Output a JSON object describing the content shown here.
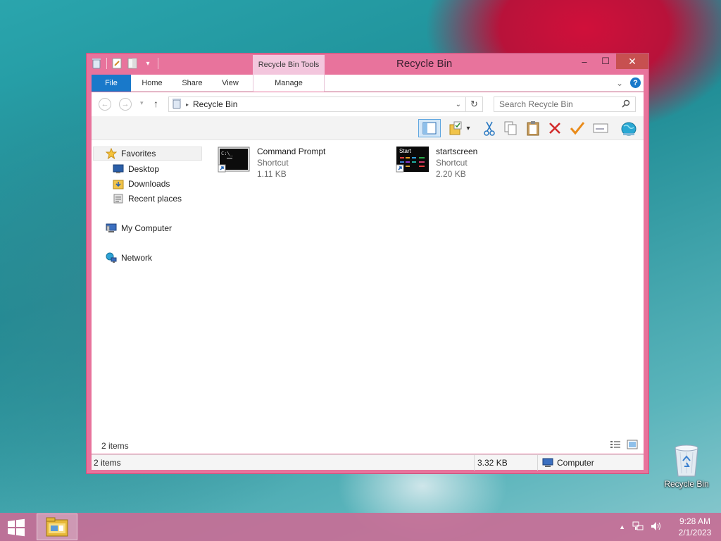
{
  "window": {
    "title": "Recycle Bin",
    "contextual_tab": "Recycle Bin Tools",
    "controls": {
      "minimize": "–",
      "maximize": "☐",
      "close": "✕"
    }
  },
  "ribbon": {
    "tabs": [
      "File",
      "Home",
      "Share",
      "View",
      "Manage"
    ]
  },
  "address": {
    "path": "Recycle Bin",
    "search_placeholder": "Search Recycle Bin"
  },
  "nav": {
    "favorites": "Favorites",
    "desktop": "Desktop",
    "downloads": "Downloads",
    "recent": "Recent places",
    "computer": "My Computer",
    "network": "Network"
  },
  "files": [
    {
      "name": "Command Prompt",
      "type": "Shortcut",
      "size": "1.11 KB",
      "icon": "command-prompt-icon"
    },
    {
      "name": "startscreen",
      "type": "Shortcut",
      "size": "2.20 KB",
      "icon": "start-screen-icon",
      "thumb_text": "Start"
    }
  ],
  "items_summary": "2 items",
  "status": {
    "items": "2 items",
    "size": "3.32 KB",
    "location": "Computer"
  },
  "desktop_icon": {
    "label": "Recycle Bin"
  },
  "taskbar": {
    "time": "9:28 AM",
    "date": "2/1/2023"
  },
  "colors": {
    "window_frame": "#e8739c",
    "file_tab": "#1979ca",
    "taskbar": "#c76e96"
  }
}
